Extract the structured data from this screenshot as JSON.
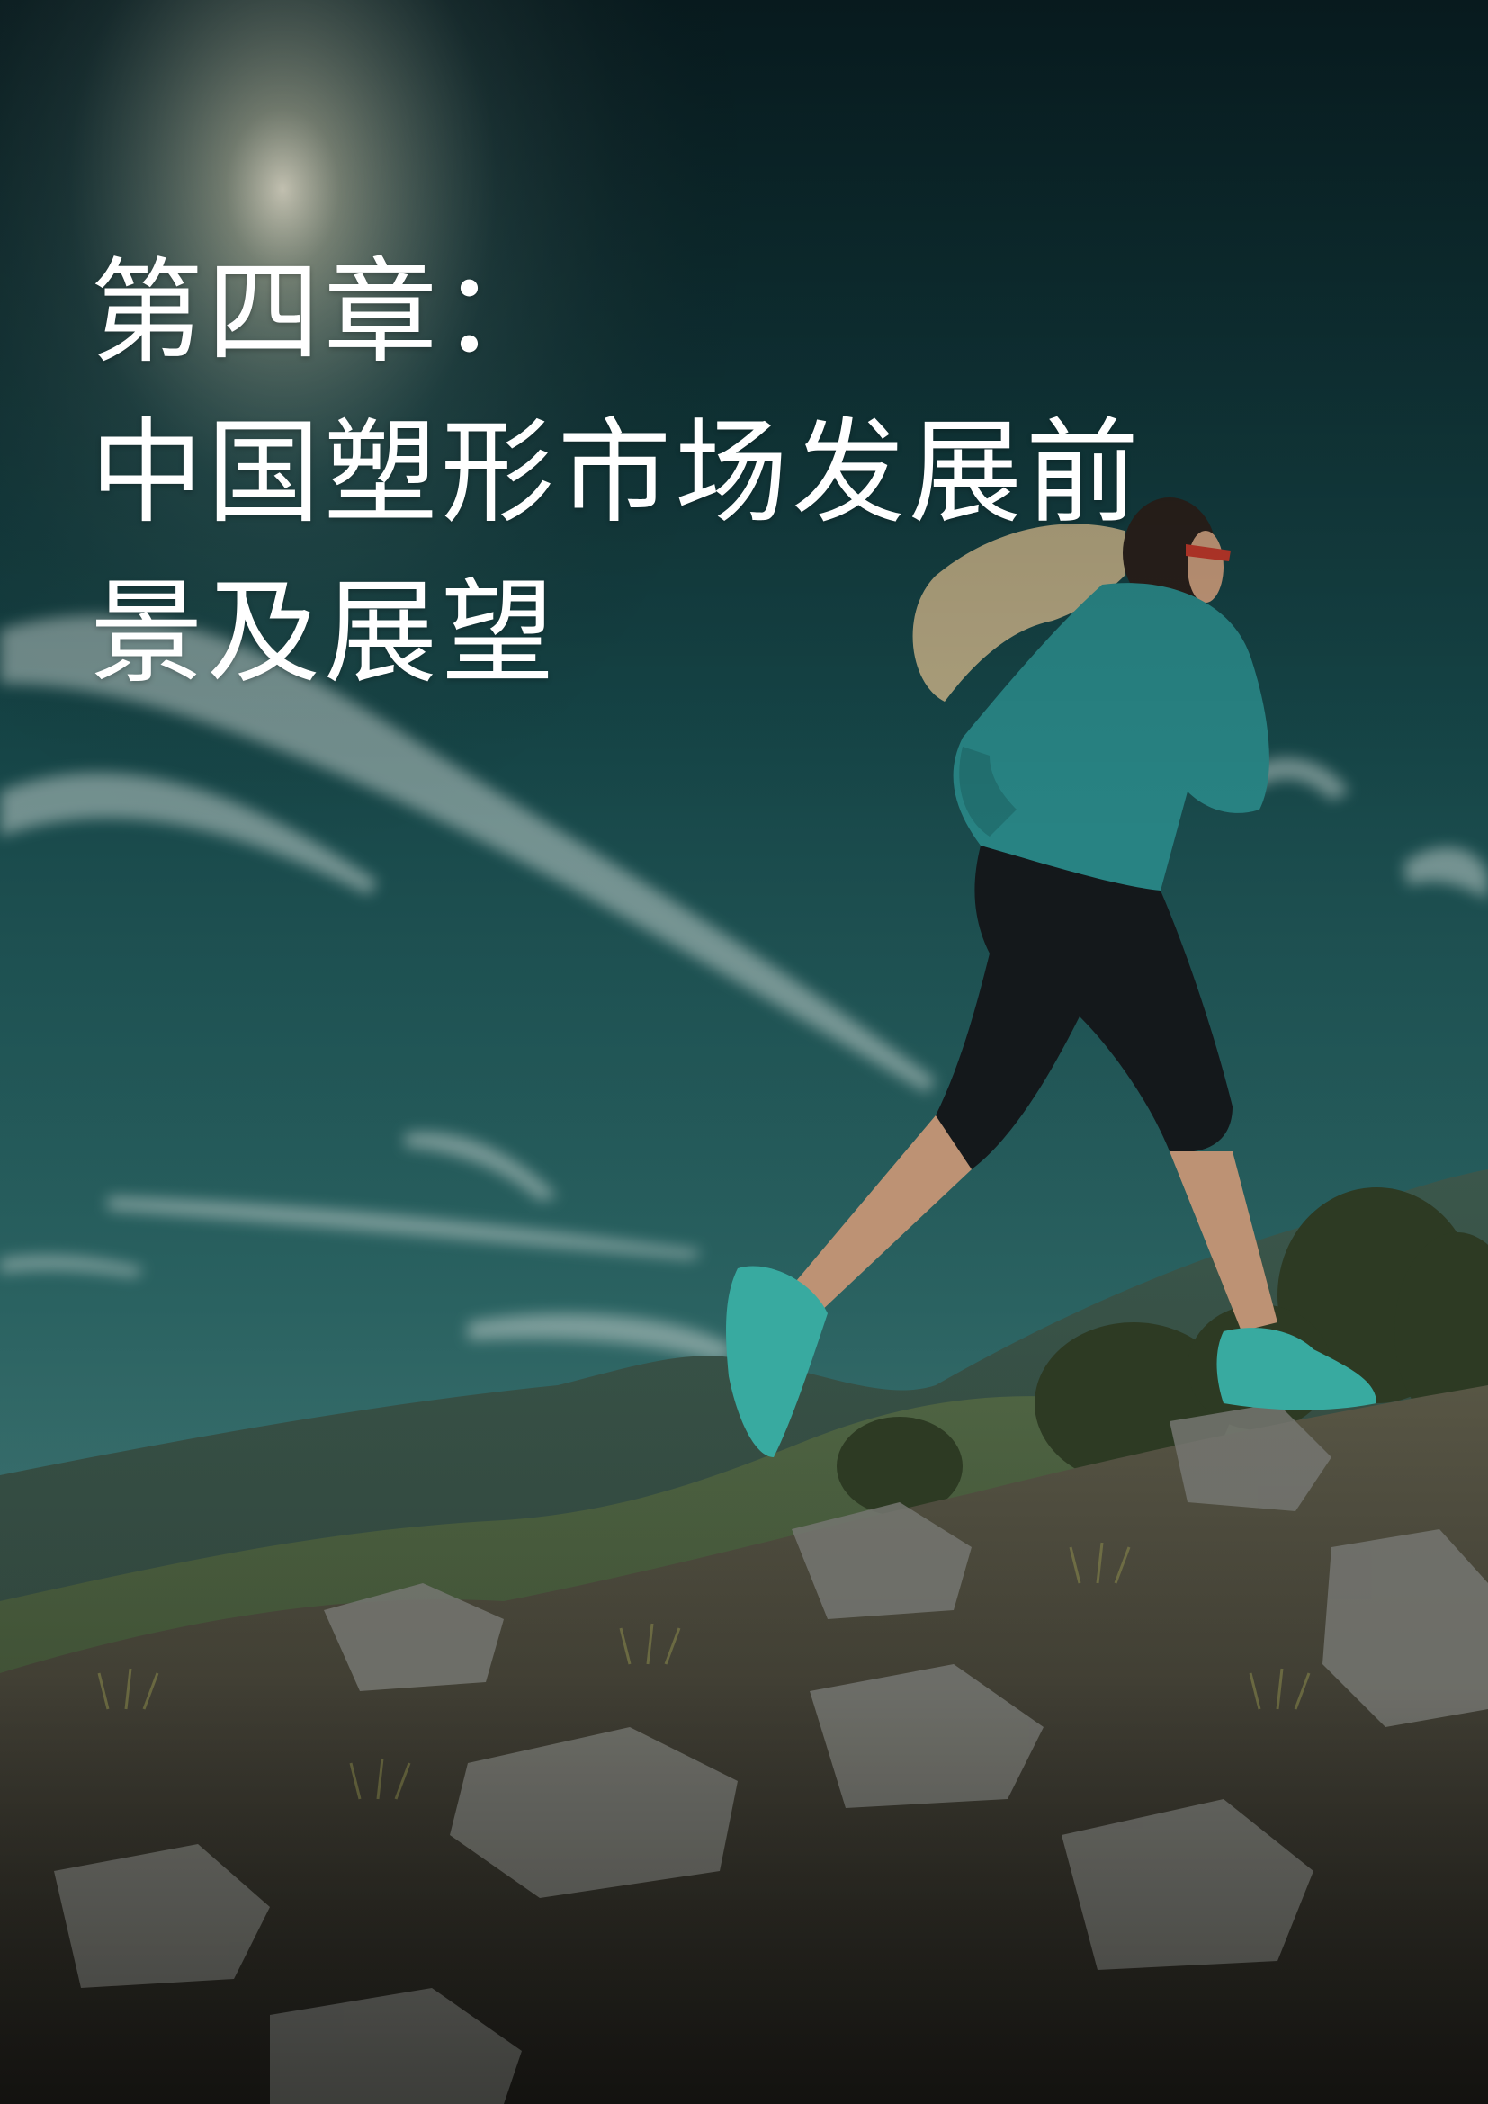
{
  "chapter": {
    "title_lines": [
      "第四章：",
      "中国塑形市场发展前",
      "景及展望"
    ]
  },
  "cover_photo": {
    "subject": "trail-runner-on-mountain-ridge",
    "colors": {
      "sky_top": "#0b2a30",
      "sky_mid": "#1d5a5a",
      "sky_low": "#3f7a78",
      "jacket": "#2a8a8a",
      "shoes": "#3bb3a8",
      "rocks": "#6d6e6a",
      "grass": "#7a7a3a"
    }
  }
}
